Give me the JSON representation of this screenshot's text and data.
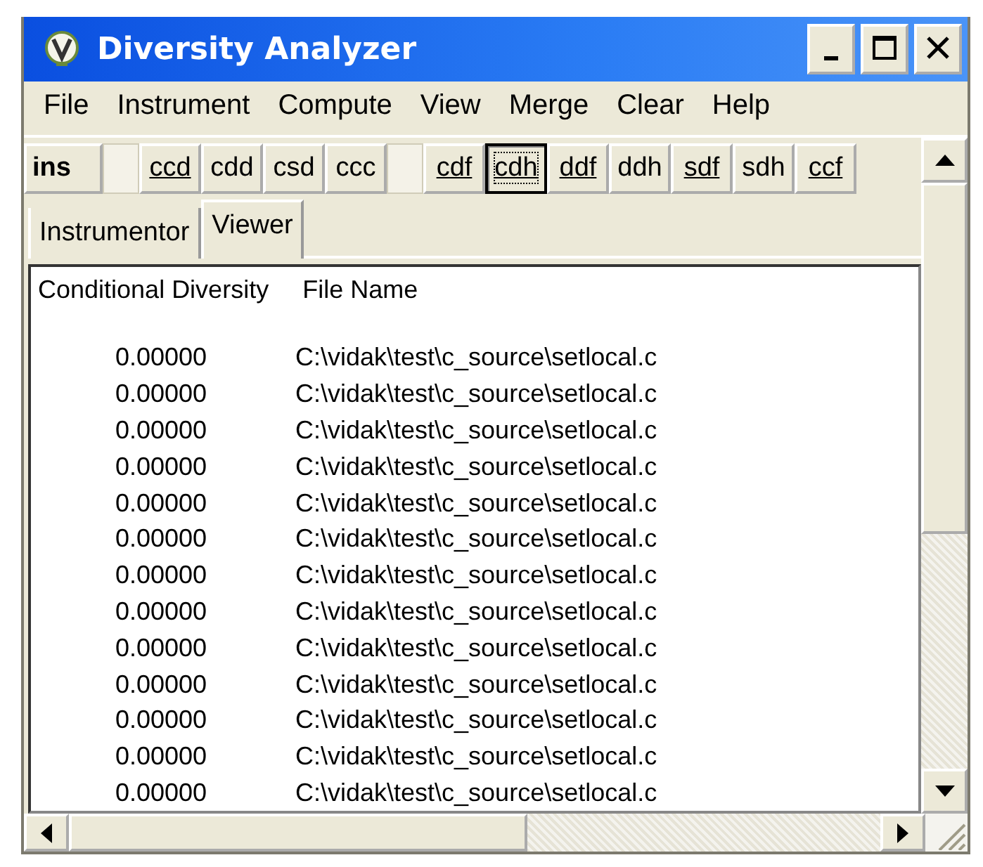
{
  "window": {
    "title": "Diversity Analyzer"
  },
  "menu": [
    "File",
    "Instrument",
    "Compute",
    "View",
    "Merge",
    "Clear",
    "Help"
  ],
  "toolbar": [
    {
      "kind": "button",
      "label": "ins",
      "bold": true,
      "underlined": false,
      "selected": false
    },
    {
      "kind": "spacer"
    },
    {
      "kind": "button",
      "label": "ccd",
      "bold": false,
      "underlined": true,
      "selected": false
    },
    {
      "kind": "button",
      "label": "cdd",
      "bold": false,
      "underlined": false,
      "selected": false
    },
    {
      "kind": "button",
      "label": "csd",
      "bold": false,
      "underlined": false,
      "selected": false
    },
    {
      "kind": "button",
      "label": "ccc",
      "bold": false,
      "underlined": false,
      "selected": false
    },
    {
      "kind": "spacer"
    },
    {
      "kind": "button",
      "label": "cdf",
      "bold": false,
      "underlined": true,
      "selected": false
    },
    {
      "kind": "button",
      "label": "cdh",
      "bold": false,
      "underlined": true,
      "selected": true
    },
    {
      "kind": "button",
      "label": "ddf",
      "bold": false,
      "underlined": true,
      "selected": false
    },
    {
      "kind": "button",
      "label": "ddh",
      "bold": false,
      "underlined": false,
      "selected": false
    },
    {
      "kind": "button",
      "label": "sdf",
      "bold": false,
      "underlined": true,
      "selected": false
    },
    {
      "kind": "button",
      "label": "sdh",
      "bold": false,
      "underlined": false,
      "selected": false
    },
    {
      "kind": "button",
      "label": "ccf",
      "bold": false,
      "underlined": true,
      "selected": false
    }
  ],
  "tabs": [
    {
      "label": "Instrumentor",
      "selected": false
    },
    {
      "label": "Viewer",
      "selected": true
    }
  ],
  "table": {
    "columns": [
      "Conditional Diversity",
      "File Name"
    ],
    "rows": [
      [
        "0.00000",
        "C:\\vidak\\test\\c_source\\setlocal.c"
      ],
      [
        "0.00000",
        "C:\\vidak\\test\\c_source\\setlocal.c"
      ],
      [
        "0.00000",
        "C:\\vidak\\test\\c_source\\setlocal.c"
      ],
      [
        "0.00000",
        "C:\\vidak\\test\\c_source\\setlocal.c"
      ],
      [
        "0.00000",
        "C:\\vidak\\test\\c_source\\setlocal.c"
      ],
      [
        "0.00000",
        "C:\\vidak\\test\\c_source\\setlocal.c"
      ],
      [
        "0.00000",
        "C:\\vidak\\test\\c_source\\setlocal.c"
      ],
      [
        "0.00000",
        "C:\\vidak\\test\\c_source\\setlocal.c"
      ],
      [
        "0.00000",
        "C:\\vidak\\test\\c_source\\setlocal.c"
      ],
      [
        "0.00000",
        "C:\\vidak\\test\\c_source\\setlocal.c"
      ],
      [
        "0.00000",
        "C:\\vidak\\test\\c_source\\setlocal.c"
      ],
      [
        "0.00000",
        "C:\\vidak\\test\\c_source\\setlocal.c"
      ],
      [
        "0.00000",
        "C:\\vidak\\test\\c_source\\setlocal.c"
      ]
    ]
  }
}
